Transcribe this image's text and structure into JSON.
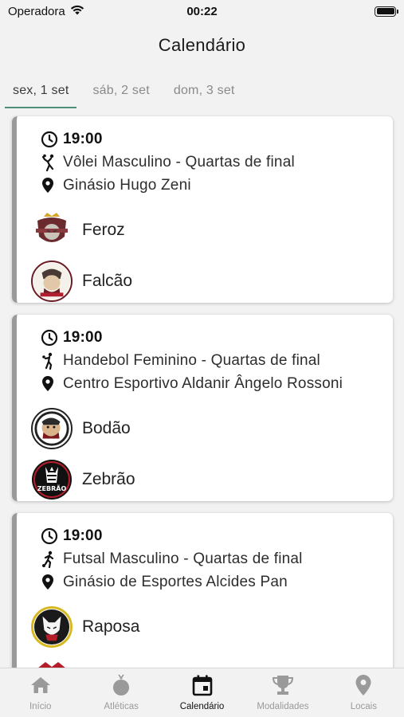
{
  "status_bar": {
    "carrier": "Operadora",
    "time": "00:22"
  },
  "header": {
    "title": "Calendário"
  },
  "tabs": [
    {
      "label": "sex, 1 set",
      "active": true
    },
    {
      "label": "sáb, 2 set",
      "active": false
    },
    {
      "label": "dom, 3 set",
      "active": false
    }
  ],
  "games": [
    {
      "time": "19:00",
      "sport": "Vôlei Masculino - Quartas de final",
      "sport_icon": "volleyball-player-icon",
      "venue": "Ginásio Hugo Zeni",
      "teams": [
        {
          "name": "Feroz",
          "logo": "feroz-logo"
        },
        {
          "name": "Falcão",
          "logo": "falcao-logo"
        }
      ]
    },
    {
      "time": "19:00",
      "sport": "Handebol Feminino - Quartas de final",
      "sport_icon": "handball-player-icon",
      "venue": "Centro Esportivo Aldanir Ângelo Rossoni",
      "teams": [
        {
          "name": "Bodão",
          "logo": "bodao-logo"
        },
        {
          "name": "Zebrão",
          "logo": "zebrao-logo",
          "logo_text": "ZEBRÃO"
        }
      ]
    },
    {
      "time": "19:00",
      "sport": "Futsal Masculino - Quartas de final",
      "sport_icon": "soccer-player-icon",
      "venue": "Ginásio de Esportes Alcides Pan",
      "teams": [
        {
          "name": "Raposa",
          "logo": "raposa-logo"
        }
      ]
    }
  ],
  "tabbar": [
    {
      "label": "Início",
      "icon": "home-icon",
      "active": false
    },
    {
      "label": "Atléticas",
      "icon": "medal-icon",
      "active": false
    },
    {
      "label": "Calendário",
      "icon": "calendar-icon",
      "active": true
    },
    {
      "label": "Modalidades",
      "icon": "trophy-icon",
      "active": false
    },
    {
      "label": "Locais",
      "icon": "location-pin-icon",
      "active": false
    }
  ],
  "colors": {
    "accent": "#4e8e7a",
    "card_border": "#9a9a9a",
    "inactive": "#9a9a9a"
  }
}
